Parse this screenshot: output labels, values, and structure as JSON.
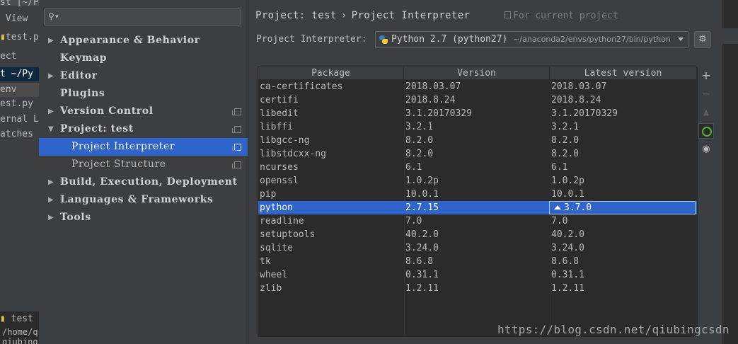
{
  "ide_background": {
    "lines": [
      "st [~/Py",
      "View",
      "test.p",
      "ect",
      "t ~/Py",
      "env",
      "est.py",
      "ernal L",
      "atches",
      "test",
      "/home/q",
      "qiubing"
    ]
  },
  "settings_tree": {
    "search_placeholder": "",
    "items": [
      {
        "label": "Appearance & Behavior",
        "expandable": true,
        "expanded": false
      },
      {
        "label": "Keymap",
        "expandable": false
      },
      {
        "label": "Editor",
        "expandable": true,
        "expanded": false
      },
      {
        "label": "Plugins",
        "expandable": false
      },
      {
        "label": "Version Control",
        "expandable": true,
        "expanded": false
      },
      {
        "label": "Project: test",
        "expandable": true,
        "expanded": true
      },
      {
        "label": "Project Interpreter",
        "child": true,
        "selected": true
      },
      {
        "label": "Project Structure",
        "child": true
      },
      {
        "label": "Build, Execution, Deployment",
        "expandable": true,
        "expanded": false
      },
      {
        "label": "Languages & Frameworks",
        "expandable": true,
        "expanded": false
      },
      {
        "label": "Tools",
        "expandable": true,
        "expanded": false
      }
    ]
  },
  "content": {
    "breadcrumb_project": "Project: test",
    "breadcrumb_page": "Project Interpreter",
    "for_current_project": "For current project",
    "interpreter_label": "Project Interpreter:",
    "interpreter_name": "Python 2.7 (python27)",
    "interpreter_path": "~/anaconda2/envs/python27/bin/python"
  },
  "table": {
    "headers": [
      "Package",
      "Version",
      "Latest version"
    ],
    "rows": [
      {
        "package": "ca-certificates",
        "version": "2018.03.07",
        "latest": "2018.03.07"
      },
      {
        "package": "certifi",
        "version": "2018.8.24",
        "latest": "2018.8.24"
      },
      {
        "package": "libedit",
        "version": "3.1.20170329",
        "latest": "3.1.20170329"
      },
      {
        "package": "libffi",
        "version": "3.2.1",
        "latest": "3.2.1"
      },
      {
        "package": "libgcc-ng",
        "version": "8.2.0",
        "latest": "8.2.0"
      },
      {
        "package": "libstdcxx-ng",
        "version": "8.2.0",
        "latest": "8.2.0"
      },
      {
        "package": "ncurses",
        "version": "6.1",
        "latest": "6.1"
      },
      {
        "package": "openssl",
        "version": "1.0.2p",
        "latest": "1.0.2p"
      },
      {
        "package": "pip",
        "version": "10.0.1",
        "latest": "10.0.1"
      },
      {
        "package": "python",
        "version": "2.7.15",
        "latest": "3.7.0",
        "selected": true,
        "upgrade": true
      },
      {
        "package": "readline",
        "version": "7.0",
        "latest": "7.0"
      },
      {
        "package": "setuptools",
        "version": "40.2.0",
        "latest": "40.2.0"
      },
      {
        "package": "sqlite",
        "version": "3.24.0",
        "latest": "3.24.0"
      },
      {
        "package": "tk",
        "version": "8.6.8",
        "latest": "8.6.8"
      },
      {
        "package": "wheel",
        "version": "0.31.1",
        "latest": "0.31.1"
      },
      {
        "package": "zlib",
        "version": "1.2.11",
        "latest": "1.2.11"
      }
    ]
  },
  "toolbar": {
    "add_icon": "plus-icon",
    "remove_icon": "minus-icon",
    "upgrade_icon": "triangle-up-icon",
    "conda_icon": "green-circle-icon",
    "show_early_icon": "eye-icon"
  },
  "watermark": "https://blog.csdn.net/qiubingcsdn",
  "colors": {
    "selection": "#2f65ca",
    "background": "#3c3f41",
    "table_background": "#2b2b2b",
    "conda_green": "#55b03c"
  }
}
